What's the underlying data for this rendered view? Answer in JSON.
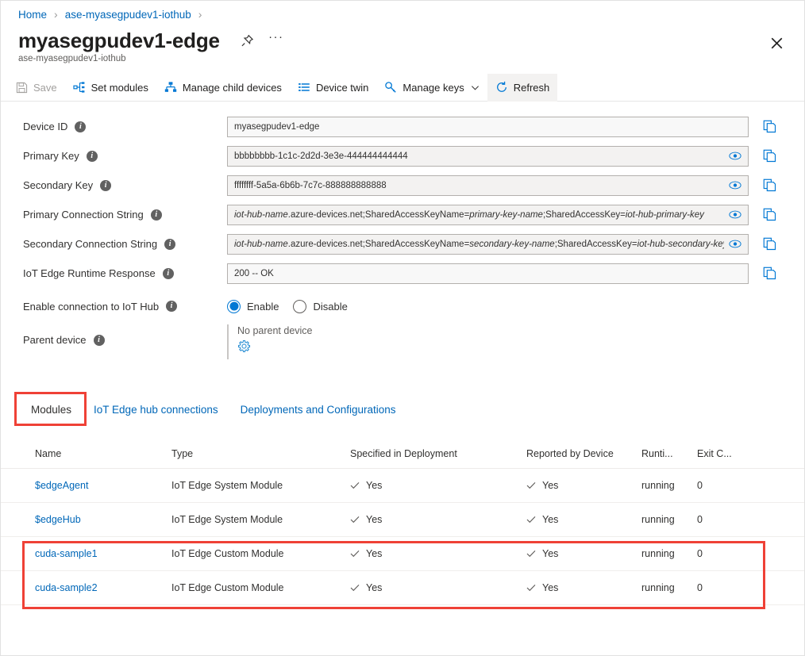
{
  "breadcrumb": {
    "items": [
      {
        "label": "Home"
      },
      {
        "label": "ase-myasegpudev1-iothub"
      }
    ],
    "separator": "›"
  },
  "header": {
    "title": "myasegpudev1-edge",
    "subtitle": "ase-myasegpudev1-iothub",
    "pin_icon": "pin-icon",
    "more_icon": "ellipsis-icon",
    "more_label": "···",
    "close_icon": "close-icon"
  },
  "toolbar": {
    "items": [
      {
        "label": "Save",
        "icon": "save-icon",
        "disabled": true,
        "active": false
      },
      {
        "label": "Set modules",
        "icon": "set-modules-icon",
        "disabled": false,
        "active": false
      },
      {
        "label": "Manage child devices",
        "icon": "hierarchy-icon",
        "disabled": false,
        "active": false
      },
      {
        "label": "Device twin",
        "icon": "list-icon",
        "disabled": false,
        "active": false
      },
      {
        "label": "Manage keys",
        "icon": "key-icon",
        "disabled": false,
        "active": false,
        "chevron": true
      },
      {
        "label": "Refresh",
        "icon": "refresh-icon",
        "disabled": false,
        "active": true
      }
    ]
  },
  "form": {
    "fields": [
      {
        "label": "Device ID",
        "info_icon": "info-icon",
        "value": "myasegpudev1-edge",
        "has_eye": false,
        "has_copy": true,
        "copy_icon": "copy-icon",
        "italic_parts": []
      },
      {
        "label": "Primary Key",
        "info_icon": "info-icon",
        "value": "bbbbbbbb-1c1c-2d2d-3e3e-444444444444",
        "has_eye": true,
        "eye_icon": "eye-icon",
        "has_copy": true,
        "copy_icon": "copy-icon",
        "italic_parts": []
      },
      {
        "label": "Secondary Key",
        "info_icon": "info-icon",
        "value": "ffffffff-5a5a-6b6b-7c7c-888888888888",
        "has_eye": true,
        "eye_icon": "eye-icon",
        "has_copy": true,
        "copy_icon": "copy-icon",
        "italic_parts": []
      },
      {
        "label": "Primary Connection String",
        "info_icon": "info-icon",
        "value": "iot-hub-name.azure-devices.net;SharedAccessKeyName=primary-key-name;SharedAccessKey=iot-hub-primary-key",
        "has_eye": true,
        "eye_icon": "eye-icon",
        "has_copy": true,
        "copy_icon": "copy-icon",
        "italic_parts": [
          "iot-hub-name",
          "primary-key-name",
          "iot-hub-primary-key"
        ]
      },
      {
        "label": "Secondary Connection String",
        "info_icon": "info-icon",
        "value": "iot-hub-name.azure-devices.net;SharedAccessKeyName=secondary-key-name;SharedAccessKey=iot-hub-secondary-key",
        "has_eye": true,
        "eye_icon": "eye-icon",
        "has_copy": true,
        "copy_icon": "copy-icon",
        "italic_parts": [
          "iot-hub-name",
          "secondary-key-name",
          "iot-hub-secondary-key"
        ]
      },
      {
        "label": "IoT Edge Runtime Response",
        "info_icon": "info-icon",
        "value": "200 -- OK",
        "has_eye": false,
        "has_copy": true,
        "copy_icon": "copy-icon",
        "italic_parts": []
      }
    ],
    "connection_toggle": {
      "label": "Enable connection to IoT Hub",
      "info_icon": "info-icon",
      "options": [
        {
          "label": "Enable",
          "checked": true
        },
        {
          "label": "Disable",
          "checked": false
        }
      ]
    },
    "parent_device": {
      "label": "Parent device",
      "info_icon": "info-icon",
      "value": "No parent device",
      "gear_icon": "gear-icon"
    }
  },
  "tabs": {
    "items": [
      {
        "label": "Modules",
        "selected": true
      },
      {
        "label": "IoT Edge hub connections",
        "selected": false
      },
      {
        "label": "Deployments and Configurations",
        "selected": false
      }
    ],
    "highlight_color": "#ef4136"
  },
  "table": {
    "columns": [
      "Name",
      "Type",
      "Specified in Deployment",
      "Reported by Device",
      "Runti...",
      "Exit C..."
    ],
    "rows": [
      {
        "name": "$edgeAgent",
        "type": "IoT Edge System Module",
        "specified": "Yes",
        "reported": "Yes",
        "runtime": "running",
        "exit_code": "0",
        "highlighted": false
      },
      {
        "name": "$edgeHub",
        "type": "IoT Edge System Module",
        "specified": "Yes",
        "reported": "Yes",
        "runtime": "running",
        "exit_code": "0",
        "highlighted": false
      },
      {
        "name": "cuda-sample1",
        "type": "IoT Edge Custom Module",
        "specified": "Yes",
        "reported": "Yes",
        "runtime": "running",
        "exit_code": "0",
        "highlighted": true
      },
      {
        "name": "cuda-sample2",
        "type": "IoT Edge Custom Module",
        "specified": "Yes",
        "reported": "Yes",
        "runtime": "running",
        "exit_code": "0",
        "highlighted": true
      }
    ],
    "check_icon": "check-icon"
  },
  "colors": {
    "link": "#0067b8",
    "accent": "#0078d4",
    "highlight": "#ef4136",
    "field_bg": "#f3f2f1"
  }
}
